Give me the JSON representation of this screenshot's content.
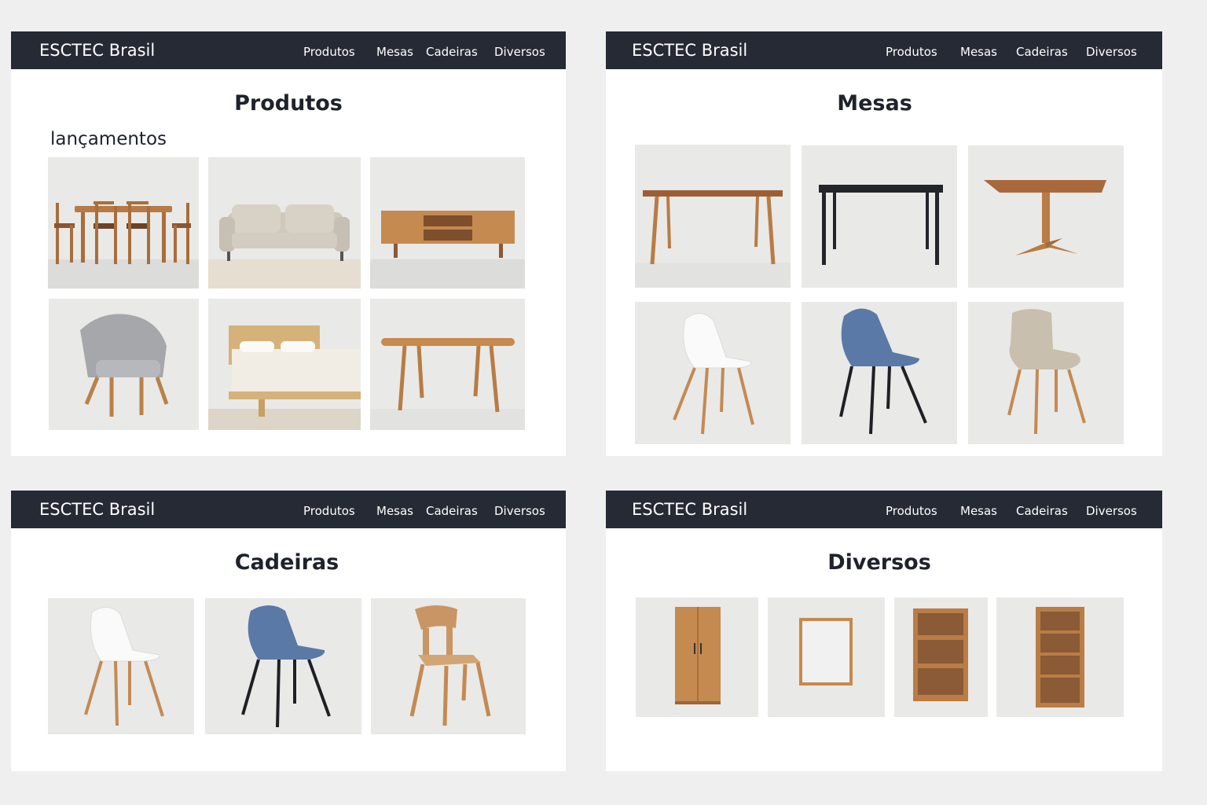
{
  "brand": "ESCTEC Brasil",
  "nav": [
    "Produtos",
    "Mesas",
    "Cadeiras",
    "Diversos"
  ],
  "pages": {
    "produtos": {
      "title": "Produtos",
      "subtitle": "lançamentos"
    },
    "mesas": {
      "title": "Mesas"
    },
    "cadeiras": {
      "title": "Cadeiras"
    },
    "diversos": {
      "title": "Diversos"
    }
  },
  "colors": {
    "nav_bg": "#262a35",
    "tile_bg": "#e9e9e7",
    "wood": "#c48a52",
    "dark_wood": "#8b5a36",
    "chair_blue": "#5a79a6",
    "chair_grey": "#a6a7aa"
  },
  "icons": {
    "p1": [
      "dining-set-icon",
      "sofa-icon",
      "tv-stand-icon",
      "armchair-icon",
      "bed-icon",
      "oval-table-icon"
    ],
    "p2": [
      "wooden-table-icon",
      "black-table-icon",
      "pedestal-table-icon",
      "white-chair-icon",
      "blue-chair-icon",
      "beige-chair-icon"
    ],
    "p3": [
      "white-chair-icon",
      "blue-chair-icon",
      "wooden-chair-icon"
    ],
    "p4": [
      "wardrobe-icon",
      "frame-icon",
      "shelf-icon",
      "bookcase-icon"
    ]
  }
}
